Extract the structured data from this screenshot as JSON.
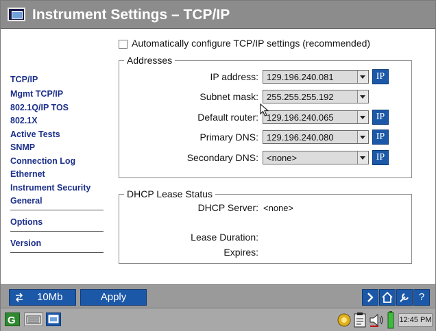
{
  "window": {
    "title": "Instrument Settings – TCP/IP"
  },
  "sidebar": {
    "items": [
      {
        "label": "TCP/IP"
      },
      {
        "label": "Mgmt TCP/IP"
      },
      {
        "label": "802.1Q/IP TOS"
      },
      {
        "label": "802.1X"
      },
      {
        "label": "Active Tests"
      },
      {
        "label": "SNMP"
      },
      {
        "label": "Connection Log"
      },
      {
        "label": "Ethernet"
      },
      {
        "label": "Instrument Security"
      },
      {
        "label": "General"
      },
      {
        "label": "Options"
      },
      {
        "label": "Version"
      }
    ]
  },
  "auto_config": {
    "label": "Automatically configure TCP/IP settings (recommended)",
    "checked": false
  },
  "addresses": {
    "legend": "Addresses",
    "ip_button_label": "IP",
    "fields": [
      {
        "label": "IP address:",
        "value": "129.196.240.081"
      },
      {
        "label": "Subnet mask:",
        "value": "255.255.255.192"
      },
      {
        "label": "Default router:",
        "value": "129.196.240.065"
      },
      {
        "label": "Primary DNS:",
        "value": "129.196.240.080"
      },
      {
        "label": "Secondary DNS:",
        "value": "<none>"
      }
    ]
  },
  "dhcp": {
    "legend": "DHCP Lease Status",
    "server_label": "DHCP Server:",
    "server_value": "<none>",
    "lease_label": "Lease Duration:",
    "expires_label": "Expires:"
  },
  "bottom_bar": {
    "speed_label": "10Mb",
    "apply_label": "Apply",
    "help_label": "?"
  },
  "taskbar": {
    "clock": "12:45 PM"
  },
  "colors": {
    "accent": "#1c58a8",
    "nav_text": "#1b2f8a",
    "title_bar": "#8c8c8c"
  }
}
